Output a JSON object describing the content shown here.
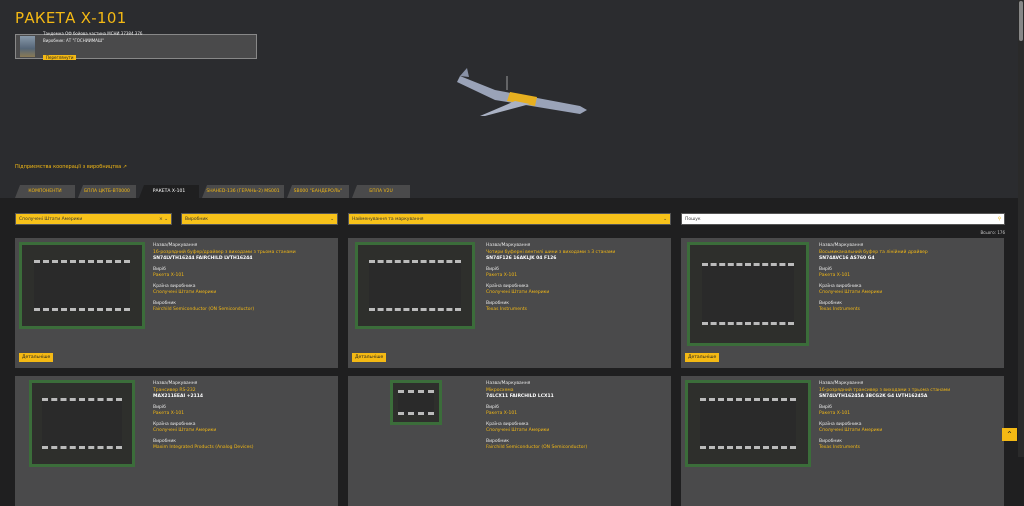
{
  "title": "РАКЕТА Х-101",
  "info": {
    "line1": "Тандемна ОФ бойова частина МСНИ 37384.376",
    "line2": "Виробник: АТ \"ГОСНИИМАШ\"",
    "button": "Переглянути"
  },
  "coop_link": "Підприємства кооперації з виробництва ↗",
  "tabs": [
    "КОМПОНЕНТИ",
    "БПЛА ЦКТБ-ВТ0000",
    "РАКЕТА Х-101",
    "SHAHED-136 (ГЕРАНЬ-2) MS001",
    "SB000 \"БАНДЕРОЛЬ\"",
    "БПЛА V2U"
  ],
  "filters": {
    "country": "Сполучені Штати Америки",
    "manufacturer": "Виробник",
    "name": "Найменування та маркування",
    "search_placeholder": "Пошук"
  },
  "count": "Всього: 176",
  "labels": {
    "name": "Назва/Маркування",
    "product": "Виріб",
    "country": "Країна виробника",
    "maker": "Виробник",
    "details": "Детальніше"
  },
  "cards": [
    {
      "desc": "16-розрядний буфер/драйвер з виходами з трьома станами",
      "pn": "SN74LVTH16244 FAIRCHILD LVTH16244",
      "product": "Ракета Х-101",
      "country": "Сполучені Штати Америки",
      "maker": "Fairchild Semiconductor (ON Semiconductor)"
    },
    {
      "desc": "Чотири буферні вентилі шини з виходами з 3 станами",
      "pn": "SN74F126 16AKLJK 04 F126",
      "product": "Ракета Х-101",
      "country": "Сполучені Штати Америки",
      "maker": "Texas Instruments"
    },
    {
      "desc": "Восьмиканальний буфер та лінійний драйвер",
      "pn": "SN74AVC16 AS760 G4",
      "product": "Ракета Х-101",
      "country": "Сполучені Штати Америки",
      "maker": "Texas Instruments"
    },
    {
      "desc": "Трансивер RS-232",
      "pn": "MAX211EEAI +2114",
      "product": "Ракета Х-101",
      "country": "Сполучені Штати Америки",
      "maker": "Maxim Integrated Products (Analog Devices)"
    },
    {
      "desc": "Мікросхема",
      "pn": "74LCX11 FAIRCHILD LCX11",
      "product": "Ракета Х-101",
      "country": "Сполучені Штати Америки",
      "maker": "Fairchild Semiconductor (ON Semiconductor)"
    },
    {
      "desc": "16-розрядний трансивер з виходами з трьома станами",
      "pn": "SN74LVTH16245A 3BCG2K G4 LVTH16245A",
      "product": "Ракета Х-101",
      "country": "Сполучені Штати Америки",
      "maker": "Texas Instruments"
    }
  ]
}
